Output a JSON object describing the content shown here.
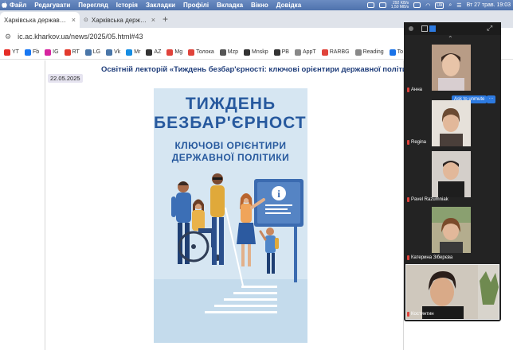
{
  "menubar": {
    "items": [
      "Файл",
      "Редагувати",
      "Перегляд",
      "Історія",
      "Закладки",
      "Профілі",
      "Вкладка",
      "Вікно",
      "Довідка"
    ],
    "net_up": "292 KB/s",
    "net_down": "1,50 MB/s",
    "lang": "UA",
    "datetime": "Вт 27 трав. 19:03"
  },
  "tabs": [
    {
      "title": "Харківська державна акаде",
      "close": "×"
    },
    {
      "title": "Харківська державна акаде",
      "close": "×"
    }
  ],
  "newtab_label": "+",
  "address": "ic.ac.kharkov.ua/news/2025/05.html#43",
  "bookmarks": [
    {
      "label": "YT",
      "color": "#e52d27"
    },
    {
      "label": "Fb",
      "color": "#1877f2"
    },
    {
      "label": "IG",
      "color": "#d6249f"
    },
    {
      "label": "RT",
      "color": "#e23a2e"
    },
    {
      "label": "LG",
      "color": "#4a76a8"
    },
    {
      "label": "Vk",
      "color": "#4a76a8"
    },
    {
      "label": "Mr",
      "color": "#168de2"
    },
    {
      "label": "AZ",
      "color": "#333333"
    },
    {
      "label": "Mg",
      "color": "#e0433b"
    },
    {
      "label": "Толока",
      "color": "#e0433b"
    },
    {
      "label": "Mzp",
      "color": "#555555"
    },
    {
      "label": "Mnskp",
      "color": "#333333"
    },
    {
      "label": "PB",
      "color": "#333333"
    },
    {
      "label": "AppT",
      "color": "#888888"
    },
    {
      "label": "RARBG",
      "color": "#e0433b"
    },
    {
      "label": "Reading",
      "color": "#888888"
    },
    {
      "label": "To",
      "color": "#1a73e8"
    }
  ],
  "article": {
    "headline": "Освітній лекторій «Тиждень безбар'єрності: ключові орієнтири державної політики",
    "date": "22.05.2025"
  },
  "poster": {
    "line1": "ТИЖДЕНЬ",
    "line2": "БЕЗБАР'ЄРНОСТІ",
    "line3": "КЛЮЧОВІ ОРІЄНТИРИ",
    "line4": "ДЕРЖАВНОЇ ПОЛІТИКИ",
    "info_glyph": "i"
  },
  "zoom": {
    "participants": [
      "Анна",
      "Regina",
      "Pavel Razumniak",
      "Катерина Зіберєва",
      "Костянтин"
    ],
    "unmute_label": "Ask to unmute",
    "more_label": "···"
  }
}
